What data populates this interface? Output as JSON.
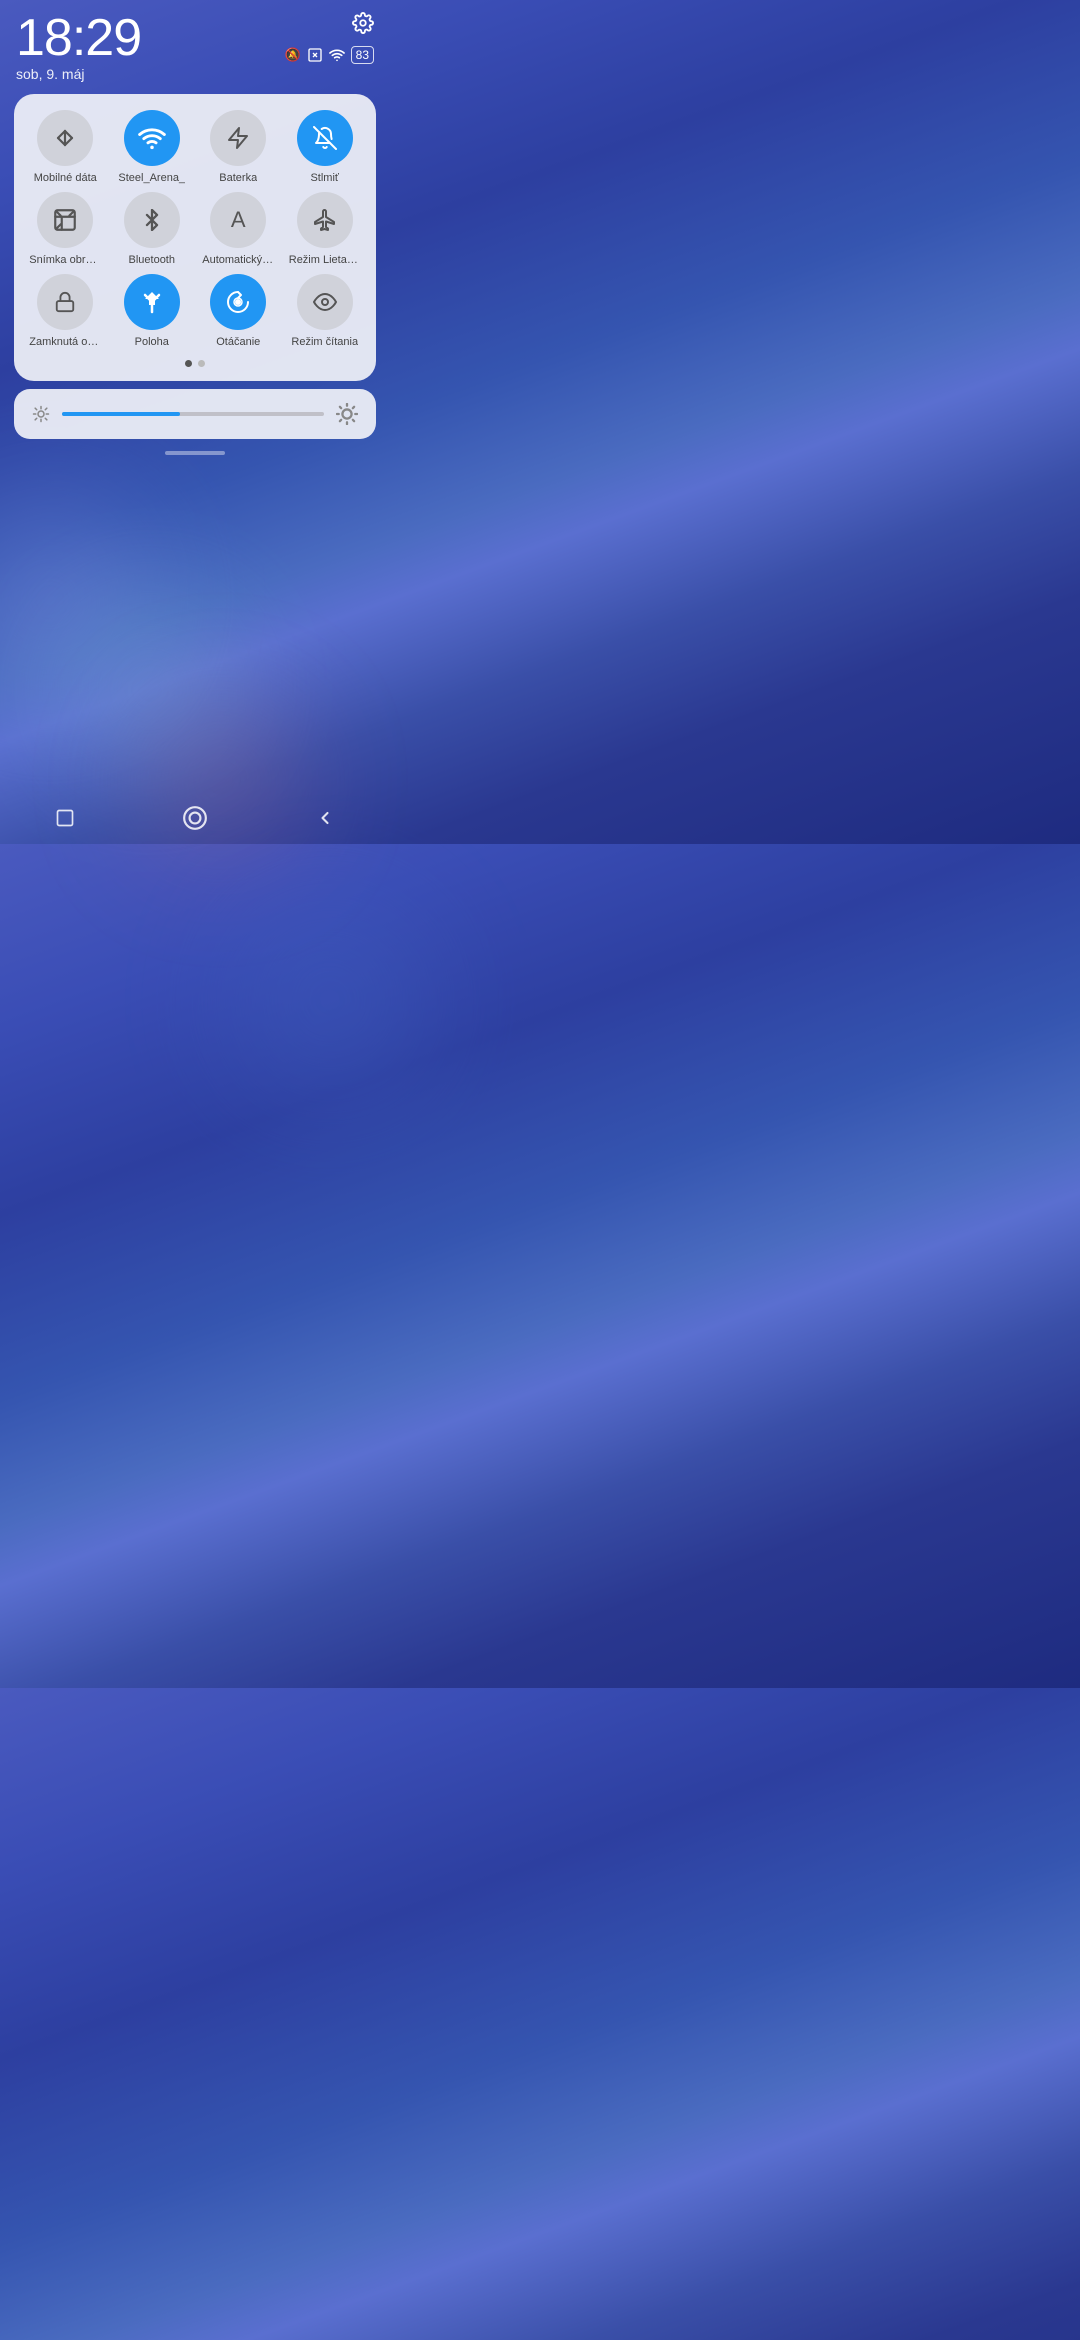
{
  "statusBar": {
    "time": "18:29",
    "date": "sob, 9. máj",
    "battery": "83",
    "settingsLabel": "Nastavenia"
  },
  "quickSettings": {
    "items": [
      {
        "id": "mobile-data",
        "label": "Mobilné dáta",
        "active": false,
        "icon": "arrows-updown"
      },
      {
        "id": "wifi",
        "label": "Steel_Arena_",
        "active": true,
        "icon": "wifi"
      },
      {
        "id": "flashlight",
        "label": "Baterka",
        "active": false,
        "icon": "flashlight"
      },
      {
        "id": "silent",
        "label": "Stlmiť",
        "active": true,
        "icon": "bell-slash"
      },
      {
        "id": "screenshot",
        "label": "Snímka obrazov.",
        "active": false,
        "icon": "screenshot"
      },
      {
        "id": "bluetooth",
        "label": "Bluetooth",
        "active": false,
        "icon": "bluetooth"
      },
      {
        "id": "auto-brightness",
        "label": "Automatický jas",
        "active": false,
        "icon": "font-a"
      },
      {
        "id": "airplane",
        "label": "Režim Lietadlo",
        "active": false,
        "icon": "airplane"
      },
      {
        "id": "lock-screen",
        "label": "Zamknutá obraz.",
        "active": false,
        "icon": "lock"
      },
      {
        "id": "location",
        "label": "Poloha",
        "active": true,
        "icon": "location"
      },
      {
        "id": "rotation",
        "label": "Otáčanie",
        "active": true,
        "icon": "rotation"
      },
      {
        "id": "reading-mode",
        "label": "Režim čítania",
        "active": false,
        "icon": "eye"
      }
    ],
    "pageDots": [
      true,
      false
    ],
    "brightness": {
      "minIcon": "sun-dim",
      "maxIcon": "sun-bright",
      "value": 45
    }
  },
  "navBar": {
    "square": "⬜",
    "home": "⬤",
    "back": "◀"
  }
}
